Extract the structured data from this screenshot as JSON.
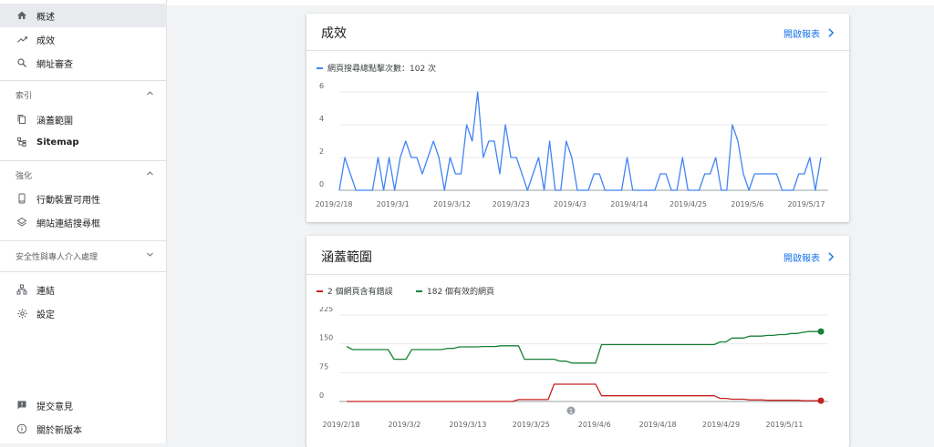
{
  "sidebar": {
    "overview": "概述",
    "performance": "成效",
    "url_inspection": "網址審查",
    "index_section": "索引",
    "coverage": "涵蓋範圍",
    "sitemap": "Sitemap",
    "enhance_section": "強化",
    "mobile_usability": "行動裝置可用性",
    "sitelinks": "網站連結搜尋框",
    "security_section": "安全性與專人介入處理",
    "links": "連結",
    "settings": "設定",
    "feedback": "提交意見",
    "new_version": "關於新版本"
  },
  "performance_card": {
    "title": "成效",
    "open_report": "開啟報表",
    "legend": "網頁搜尋總點擊次數：102 次",
    "line_color": "#4285f4"
  },
  "coverage_card": {
    "title": "涵蓋範圍",
    "open_report": "開啟報表",
    "legend_errors": "2 個網頁含有錯誤",
    "legend_valid": "182 個有效的網頁",
    "error_color": "#c5221f",
    "valid_color": "#188038",
    "annotation": "1"
  },
  "chart_data": [
    {
      "type": "line",
      "title": "成效",
      "ylim": [
        0,
        6
      ],
      "yticks": [
        "0",
        "2",
        "4",
        "6"
      ],
      "xticks": [
        "2019/2/18",
        "2019/3/1",
        "2019/3/12",
        "2019/3/23",
        "2019/4/3",
        "2019/4/14",
        "2019/4/25",
        "2019/5/6",
        "2019/5/17"
      ],
      "grid": true,
      "series": [
        {
          "name": "網頁搜尋總點擊次數",
          "values": [
            0,
            2,
            1,
            0,
            0,
            0,
            0,
            2,
            0,
            2,
            0,
            2,
            3,
            2,
            2,
            1,
            2,
            3,
            2,
            0,
            2,
            1,
            1,
            4,
            3,
            6,
            2,
            3,
            3,
            1,
            4,
            2,
            2,
            1,
            0,
            1,
            2,
            0,
            3,
            0,
            0,
            3,
            2,
            0,
            0,
            0,
            1,
            1,
            0,
            0,
            0,
            0,
            2,
            0,
            0,
            0,
            0,
            0,
            1,
            1,
            0,
            0,
            2,
            0,
            0,
            0,
            1,
            1,
            2,
            0,
            0,
            4,
            3,
            1,
            0,
            1,
            1,
            1,
            1,
            1,
            0,
            0,
            0,
            1,
            1,
            2,
            0,
            2
          ]
        }
      ]
    },
    {
      "type": "line",
      "title": "涵蓋範圍",
      "ylim": [
        0,
        225
      ],
      "yticks": [
        "0",
        "75",
        "150",
        "225"
      ],
      "xticks": [
        "2019/2/18",
        "2019/3/2",
        "2019/3/13",
        "2019/3/25",
        "2019/4/6",
        "2019/4/18",
        "2019/4/29",
        "2019/5/11"
      ],
      "grid": true,
      "series": [
        {
          "name": "有效的網頁",
          "values": [
            143,
            135,
            135,
            135,
            135,
            135,
            135,
            135,
            110,
            110,
            110,
            135,
            135,
            135,
            135,
            135,
            135,
            138,
            138,
            142,
            142,
            142,
            142,
            143,
            143,
            143,
            145,
            145,
            145,
            145,
            110,
            110,
            110,
            110,
            110,
            110,
            105,
            105,
            100,
            100,
            100,
            100,
            100,
            148,
            148,
            148,
            148,
            148,
            148,
            148,
            148,
            148,
            148,
            148,
            148,
            148,
            148,
            148,
            148,
            148,
            148,
            148,
            148,
            155,
            155,
            165,
            165,
            165,
            170,
            170,
            170,
            172,
            172,
            174,
            174,
            177,
            177,
            180,
            182,
            182,
            182
          ]
        },
        {
          "name": "含有錯誤的網頁",
          "values": [
            0,
            0,
            0,
            0,
            0,
            0,
            0,
            0,
            0,
            0,
            0,
            0,
            0,
            0,
            0,
            0,
            0,
            0,
            0,
            0,
            0,
            0,
            0,
            0,
            0,
            0,
            0,
            0,
            0,
            5,
            5,
            5,
            5,
            5,
            5,
            45,
            45,
            45,
            45,
            45,
            45,
            45,
            45,
            15,
            15,
            15,
            15,
            15,
            15,
            15,
            15,
            15,
            15,
            15,
            15,
            15,
            15,
            15,
            15,
            15,
            15,
            15,
            15,
            8,
            8,
            6,
            6,
            6,
            4,
            4,
            4,
            3,
            3,
            3,
            3,
            3,
            3,
            2,
            2,
            2,
            2
          ]
        }
      ]
    }
  ]
}
